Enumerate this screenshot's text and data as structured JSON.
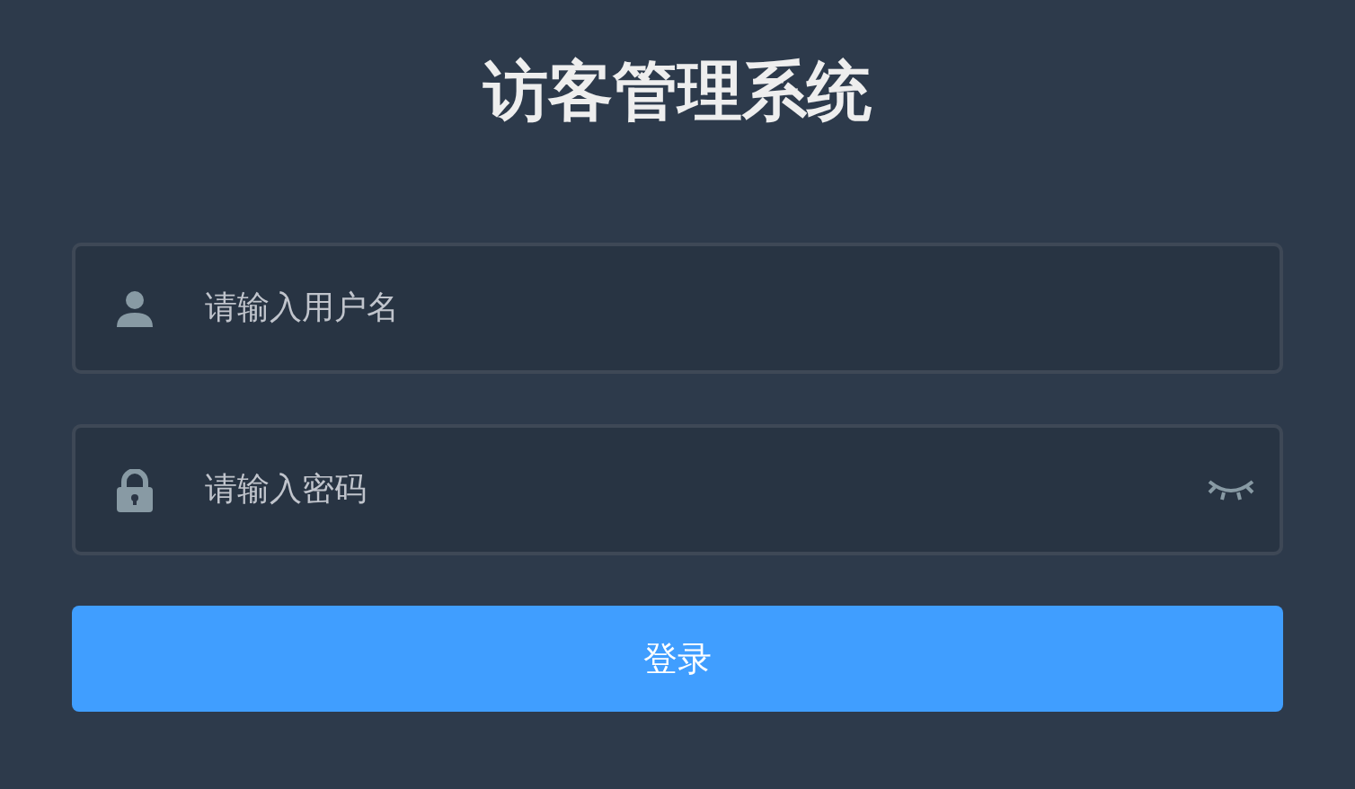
{
  "title": "访客管理系统",
  "fields": [
    {
      "kind": "user",
      "placeholder": "请输入用户名"
    },
    {
      "kind": "lock",
      "placeholder": "请输入密码",
      "password_visible": false
    }
  ],
  "login_button": "登录"
}
